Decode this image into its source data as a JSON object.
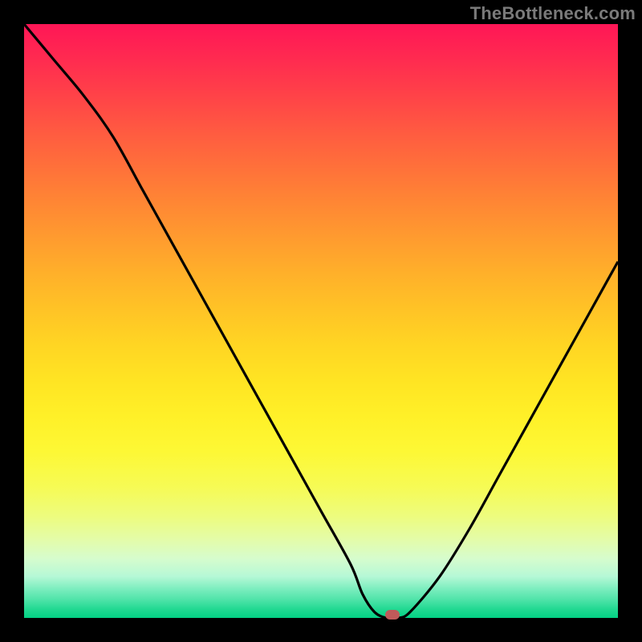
{
  "watermark": "TheBottleneck.com",
  "colors": {
    "frame": "#000000",
    "curve": "#000000",
    "marker": "#c05a5a",
    "gradient_top": "#ff1656",
    "gradient_mid": "#ffe423",
    "gradient_bottom": "#03d184"
  },
  "chart_data": {
    "type": "line",
    "title": "",
    "xlabel": "",
    "ylabel": "",
    "xlim": [
      0,
      100
    ],
    "ylim": [
      0,
      100
    ],
    "x": [
      0,
      5,
      10,
      15,
      20,
      25,
      30,
      35,
      40,
      45,
      50,
      55,
      57,
      59,
      61,
      63,
      65,
      70,
      75,
      80,
      85,
      90,
      95,
      100
    ],
    "values": [
      100,
      94,
      88,
      81,
      72,
      63,
      54,
      45,
      36,
      27,
      18,
      9,
      4,
      1,
      0,
      0,
      1,
      7,
      15,
      24,
      33,
      42,
      51,
      60
    ],
    "minimum_index": 12,
    "minimum_x": 62,
    "minimum_y": 0,
    "note": "V-shaped bottleneck curve on rainbow heat gradient; minimum flattens around x≈60–63 at y=0"
  }
}
